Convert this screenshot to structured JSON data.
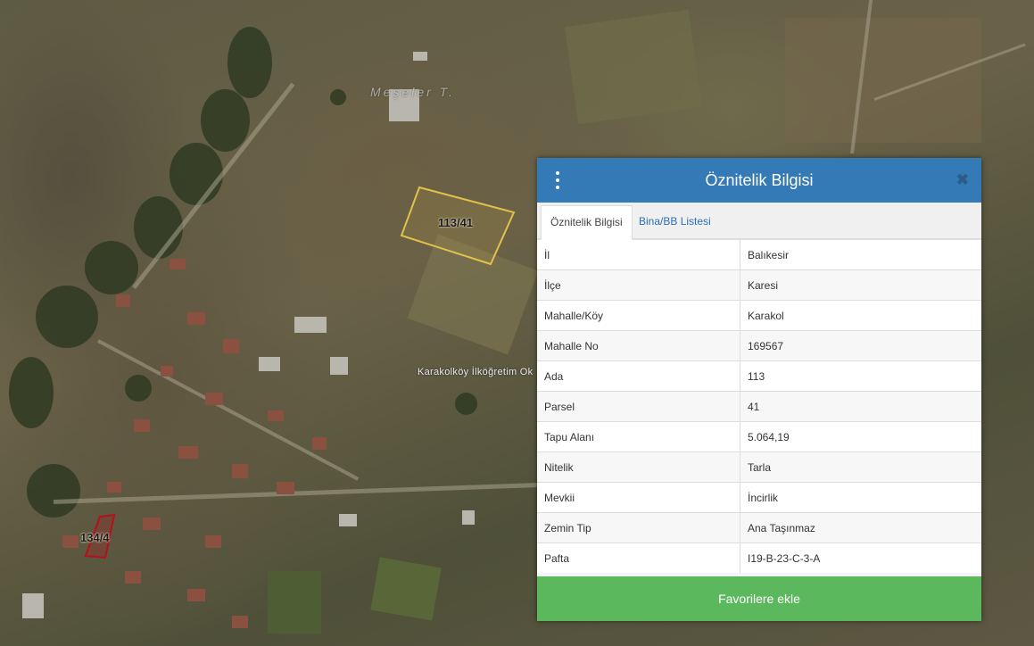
{
  "map": {
    "parcels": [
      {
        "label": "113/41",
        "color": "#e2c14a"
      },
      {
        "label": "134/4",
        "color": "#b3121a"
      }
    ],
    "labels": {
      "school": "Karakolköy İlköğretim Ok",
      "locality": "Meşeler T."
    }
  },
  "panel": {
    "title": "Öznitelik Bilgisi",
    "tabs": [
      {
        "label": "Öznitelik Bilgisi",
        "active": true
      },
      {
        "label": "Bina/BB Listesi",
        "active": false
      }
    ],
    "rows": [
      {
        "key": "İl",
        "value": "Balıkesir"
      },
      {
        "key": "İlçe",
        "value": "Karesi"
      },
      {
        "key": "Mahalle/Köy",
        "value": "Karakol"
      },
      {
        "key": "Mahalle No",
        "value": "169567"
      },
      {
        "key": "Ada",
        "value": "113"
      },
      {
        "key": "Parsel",
        "value": "41"
      },
      {
        "key": "Tapu Alanı",
        "value": "5.064,19"
      },
      {
        "key": "Nitelik",
        "value": "Tarla"
      },
      {
        "key": "Mevkii",
        "value": "İncirlik"
      },
      {
        "key": "Zemin Tip",
        "value": "Ana Taşınmaz"
      },
      {
        "key": "Pafta",
        "value": "I19-B-23-C-3-A"
      }
    ],
    "favorite_label": "Favorilere ekle",
    "icons": {
      "menu": "vertical-dots-icon",
      "close": "close-icon"
    },
    "colors": {
      "header": "#337ab7",
      "favorite": "#5cb85c",
      "link": "#2a6fb5"
    }
  }
}
